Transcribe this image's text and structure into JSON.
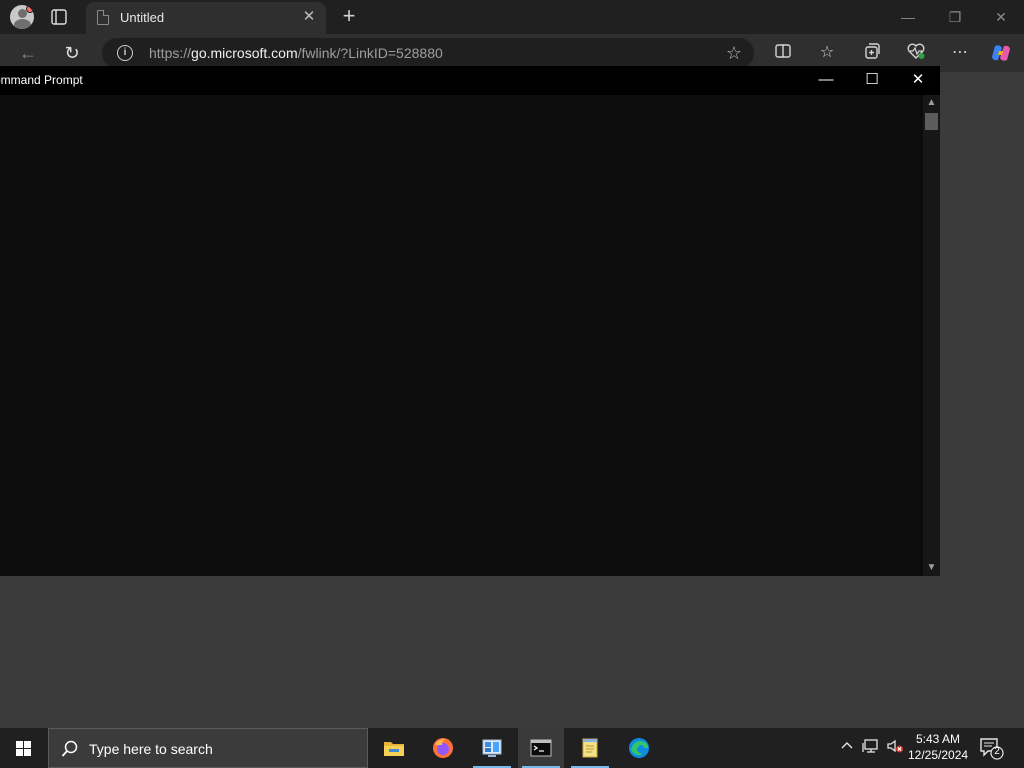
{
  "browser": {
    "tab": {
      "title": "Untitled",
      "close_icon": "close-icon"
    },
    "address": {
      "scheme": "https://",
      "domain": "go.microsoft.com",
      "path": "/fwlink/?LinkID=528880"
    },
    "icons": [
      "profile-icon",
      "tab-actions-icon",
      "page-icon",
      "new-tab-icon",
      "minimize-icon",
      "restore-icon",
      "close-icon",
      "back-icon",
      "refresh-icon",
      "info-icon",
      "favorite-star-icon",
      "split-screen-icon",
      "favorites-icon",
      "collections-icon",
      "browser-essentials-icon",
      "more-icon",
      "copilot-icon"
    ]
  },
  "cmd": {
    "title": "ommand Prompt",
    "icons": [
      "minimize-icon",
      "maximize-icon",
      "close-icon",
      "scroll-up-icon",
      "scroll-down-icon"
    ]
  },
  "taskbar": {
    "search_placeholder": "Type here to search",
    "time": "5:43 AM",
    "date": "12/25/2024",
    "notification_count": "2",
    "apps": [
      "file-explorer-icon",
      "firefox-icon",
      "control-panel-icon",
      "command-prompt-icon",
      "notepad-icon",
      "edge-icon"
    ],
    "tray_icons": [
      "chevron-up-icon",
      "network-icon",
      "volume-muted-icon"
    ],
    "accent": "#76b9ed"
  }
}
